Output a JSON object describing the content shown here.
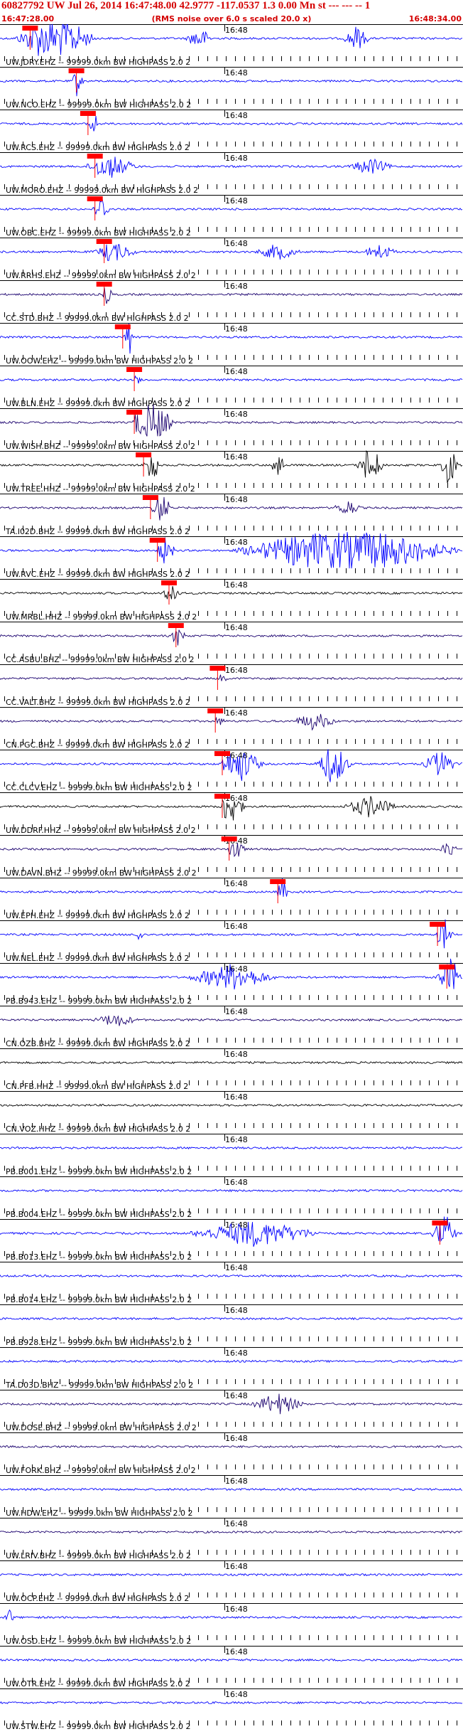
{
  "header": {
    "title": "60827792 UW Jul 26, 2014 16:47:48.00   42.9777 -117.0537  1.3 0.00 Mn st --- --- --  1",
    "start_time": "16:47:28.00",
    "note": "(RMS noise over 6.0 s scaled 20.0 x)",
    "end_time": "16:48:34.00"
  },
  "colors": {
    "title": "#d40000",
    "blue": "#0000ff",
    "navy": "#1a006e",
    "black": "#000000",
    "pick": "#ff0000"
  },
  "chart_data": {
    "type": "line",
    "title": "60827792 UW Jul 26, 2014 16:47:48.00   42.9777 -117.0537  1.3 0.00 Mn st --- --- --  1",
    "x_range": [
      "16:47:28.00",
      "16:48:34.00"
    ],
    "x_mark_label": "16:48",
    "series": [
      {
        "name": "UW.JDRY.EHZ -- 99999.0km BW  HIGHPASS  2.0  2",
        "pick": 0.065,
        "color": "blue",
        "bursts": [
          [
            0.12,
            0.09,
            6
          ],
          [
            0.43,
            0.03,
            2.5
          ],
          [
            0.77,
            0.03,
            2.8
          ]
        ]
      },
      {
        "name": "UW.NCO.EHZ -- 99999.0km BW  HIGHPASS  2.0  2",
        "pick": 0.165,
        "color": "blue",
        "bursts": [
          [
            0.165,
            0.01,
            3
          ]
        ]
      },
      {
        "name": "UW.RCS.EHZ -- 99999.0km BW  HIGHPASS  2.0  2",
        "pick": 0.19,
        "color": "blue",
        "bursts": [
          [
            0.2,
            0.01,
            4
          ]
        ]
      },
      {
        "name": "UW.MORO.EHZ -- 99999.0km BW  HIGHPASS  2.0  2",
        "pick": 0.205,
        "color": "blue",
        "bursts": [
          [
            0.24,
            0.06,
            2.5
          ],
          [
            0.8,
            0.05,
            1.8
          ]
        ]
      },
      {
        "name": "UW.OBC.EHZ -- 99999.0km BW  HIGHPASS  2.0  2",
        "pick": 0.205,
        "color": "blue",
        "bursts": [
          [
            0.22,
            0.02,
            2.5
          ]
        ]
      },
      {
        "name": "UW.RRHS.EHZ -- 99999.0km BW  HIGHPASS  2.0  2",
        "pick": 0.225,
        "color": "blue",
        "bursts": [
          [
            0.25,
            0.05,
            2
          ],
          [
            0.6,
            0.05,
            1.8
          ],
          [
            0.82,
            0.04,
            1.7
          ]
        ]
      },
      {
        "name": "CC.STD.BHZ -- 99999.0km BW  HIGHPASS  2.0  2",
        "pick": 0.225,
        "color": "navy",
        "bursts": [
          [
            0.23,
            0.01,
            1.5
          ]
        ]
      },
      {
        "name": "UW.OOW.EHZ -- 99999.0km BW  HIGHPASS  2.0  2",
        "pick": 0.265,
        "color": "blue",
        "bursts": [
          [
            0.28,
            0.01,
            4
          ]
        ]
      },
      {
        "name": "UW.BLN.EHZ -- 99999.0km BW  HIGHPASS  2.0  2",
        "pick": 0.29,
        "color": "blue",
        "bursts": []
      },
      {
        "name": "UW.WISH.BHZ -- 99999.0km BW  HIGHPASS  2.0  2",
        "pick": 0.29,
        "color": "navy",
        "bursts": [
          [
            0.33,
            0.05,
            5
          ]
        ]
      },
      {
        "name": "UW.TREE.HHZ -- 99999.0km BW  HIGHPASS  2.0  2",
        "pick": 0.31,
        "color": "black",
        "bursts": [
          [
            0.33,
            0.015,
            5
          ],
          [
            0.6,
            0.015,
            4
          ],
          [
            0.8,
            0.03,
            5
          ],
          [
            0.97,
            0.02,
            5
          ]
        ]
      },
      {
        "name": "TA.I02D.BHZ -- 99999.0km BW  HIGHPASS  2.0  2",
        "pick": 0.325,
        "color": "navy",
        "bursts": [
          [
            0.35,
            0.02,
            4
          ],
          [
            0.75,
            0.03,
            2
          ]
        ]
      },
      {
        "name": "UW.RVC.EHZ -- 99999.0km BW  HIGHPASS  2.0  2",
        "pick": 0.34,
        "color": "blue",
        "bursts": [
          [
            0.36,
            0.02,
            3
          ],
          [
            0.75,
            0.25,
            6
          ]
        ]
      },
      {
        "name": "UW.MRBL.HHZ -- 99999.0km BW  HIGHPASS  2.0  2",
        "pick": 0.365,
        "color": "black",
        "bursts": [
          [
            0.37,
            0.02,
            2.5
          ]
        ]
      },
      {
        "name": "CC.ASBU.BHZ -- 99999.0km BW  HIGHPASS  2.0  2",
        "pick": 0.38,
        "color": "navy",
        "bursts": [
          [
            0.38,
            0.01,
            2.5
          ]
        ]
      },
      {
        "name": "CC.VALT.BHZ -- 99999.0km BW  HIGHPASS  2.0  2",
        "pick": 0.47,
        "color": "navy",
        "bursts": []
      },
      {
        "name": "CN.PGC.BHZ -- 99999.0km BW  HIGHPASS  2.0  2",
        "pick": 0.465,
        "color": "navy",
        "bursts": [
          [
            0.68,
            0.05,
            2
          ]
        ]
      },
      {
        "name": "CC.CLCV.EHZ -- 99999.0km BW  HIGHPASS  2.0  2",
        "pick": 0.48,
        "color": "blue",
        "bursts": [
          [
            0.52,
            0.05,
            4
          ],
          [
            0.72,
            0.04,
            5
          ],
          [
            0.95,
            0.04,
            3
          ]
        ]
      },
      {
        "name": "UW.DDRF.HHZ -- 99999.0km BW  HIGHPASS  2.0  2",
        "pick": 0.48,
        "color": "black",
        "bursts": [
          [
            0.5,
            0.03,
            4
          ],
          [
            0.8,
            0.06,
            2.5
          ]
        ]
      },
      {
        "name": "UW.DAVN.BHZ -- 99999.0km BW  HIGHPASS  2.0  2",
        "pick": 0.495,
        "color": "navy",
        "bursts": [
          [
            0.51,
            0.02,
            3
          ],
          [
            0.97,
            0.02,
            2
          ]
        ]
      },
      {
        "name": "UW.EPH.EHZ -- 99999.0km BW  HIGHPASS  2.0  2",
        "pick": 0.6,
        "color": "blue",
        "bursts": [
          [
            0.61,
            0.01,
            3
          ]
        ]
      },
      {
        "name": "UW.NEL.EHZ -- 99999.0km BW  HIGHPASS  2.0  2",
        "pick": 0.945,
        "color": "blue",
        "bursts": [
          [
            0.3,
            0.01,
            2
          ],
          [
            0.96,
            0.02,
            3
          ]
        ]
      },
      {
        "name": "PB.B943.EHZ -- 99999.0km BW  HIGHPASS  2.0  2",
        "pick": 0.965,
        "color": "blue",
        "bursts": [
          [
            0.5,
            0.1,
            3
          ],
          [
            0.97,
            0.03,
            4
          ]
        ]
      },
      {
        "name": "CN.OZB.BHZ -- 99999.0km BW  HIGHPASS  2.0  2",
        "pick": null,
        "color": "navy",
        "bursts": [
          [
            0.25,
            0.05,
            1.5
          ]
        ]
      },
      {
        "name": "CN.PFB.HHZ -- 99999.0km BW  HIGHPASS  2.0  2",
        "pick": null,
        "color": "black",
        "bursts": []
      },
      {
        "name": "CN.VOZ.HHZ -- 99999.0km BW  HIGHPASS  2.0  2",
        "pick": null,
        "color": "black",
        "bursts": []
      },
      {
        "name": "PB.B001.EHZ -- 99999.0km BW  HIGHPASS  2.0  2",
        "pick": null,
        "color": "blue",
        "bursts": []
      },
      {
        "name": "PB.B004.EHZ -- 99999.0km BW  HIGHPASS  2.0  2",
        "pick": null,
        "color": "blue",
        "bursts": []
      },
      {
        "name": "PB.B013.EHZ -- 99999.0km BW  HIGHPASS  2.0  2",
        "pick": 0.95,
        "color": "blue",
        "bursts": [
          [
            0.55,
            0.15,
            3
          ],
          [
            0.96,
            0.03,
            4
          ]
        ]
      },
      {
        "name": "PB.B014.EHZ -- 99999.0km BW  HIGHPASS  2.0  2",
        "pick": null,
        "color": "blue",
        "bursts": []
      },
      {
        "name": "PB.B928.EHZ -- 99999.0km BW  HIGHPASS  2.0  2",
        "pick": null,
        "color": "blue",
        "bursts": []
      },
      {
        "name": "TA.D03D.BHZ -- 99999.0km BW  HIGHPASS  2.0  2",
        "pick": null,
        "color": "blue",
        "bursts": []
      },
      {
        "name": "UW.DOSE.BHZ -- 99999.0km BW  HIGHPASS  2.0  2",
        "pick": null,
        "color": "navy",
        "bursts": [
          [
            0.6,
            0.06,
            2.5
          ]
        ]
      },
      {
        "name": "UW.FORK.BHZ -- 99999.0km BW  HIGHPASS  2.0  2",
        "pick": null,
        "color": "navy",
        "bursts": []
      },
      {
        "name": "UW.HDW.EHZ -- 99999.0km BW  HIGHPASS  2.0  2",
        "pick": null,
        "color": "blue",
        "bursts": []
      },
      {
        "name": "UW.LRIV.BHZ -- 99999.0km BW  HIGHPASS  2.0  2",
        "pick": null,
        "color": "navy",
        "bursts": []
      },
      {
        "name": "UW.OCP.EHZ -- 99999.0km BW  HIGHPASS  2.0  2",
        "pick": null,
        "color": "blue",
        "bursts": []
      },
      {
        "name": "UW.OSD.EHZ -- 99999.0km BW  HIGHPASS  2.0  2",
        "pick": null,
        "color": "blue",
        "bursts": [
          [
            0.02,
            0.01,
            2
          ]
        ]
      },
      {
        "name": "UW.OTR.EHZ -- 99999.0km BW  HIGHPASS  2.0  2",
        "pick": null,
        "color": "blue",
        "bursts": []
      },
      {
        "name": "UW.STW.EHZ -- 99999.0km BW  HIGHPASS  2.0  2",
        "pick": null,
        "color": "blue",
        "bursts": []
      }
    ]
  }
}
